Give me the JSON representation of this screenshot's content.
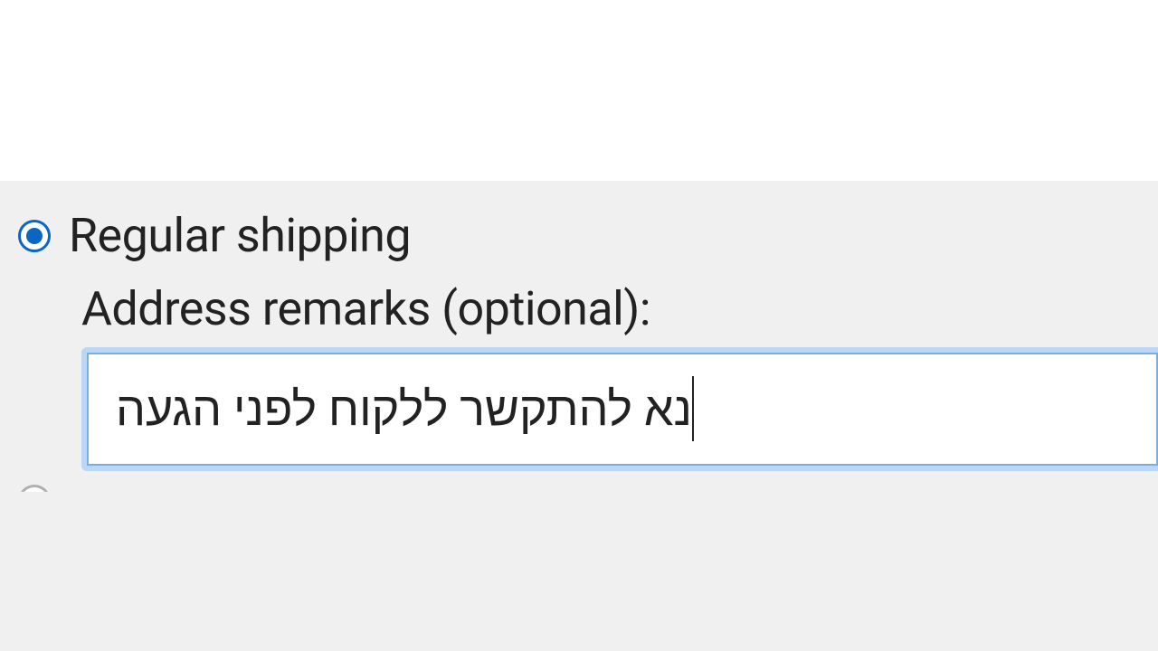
{
  "shipping": {
    "option_selected_label": "Regular shipping",
    "remarks_label": "Address remarks (optional):",
    "remarks_value": "נא להתקשר ללקוח לפני הגעה"
  }
}
